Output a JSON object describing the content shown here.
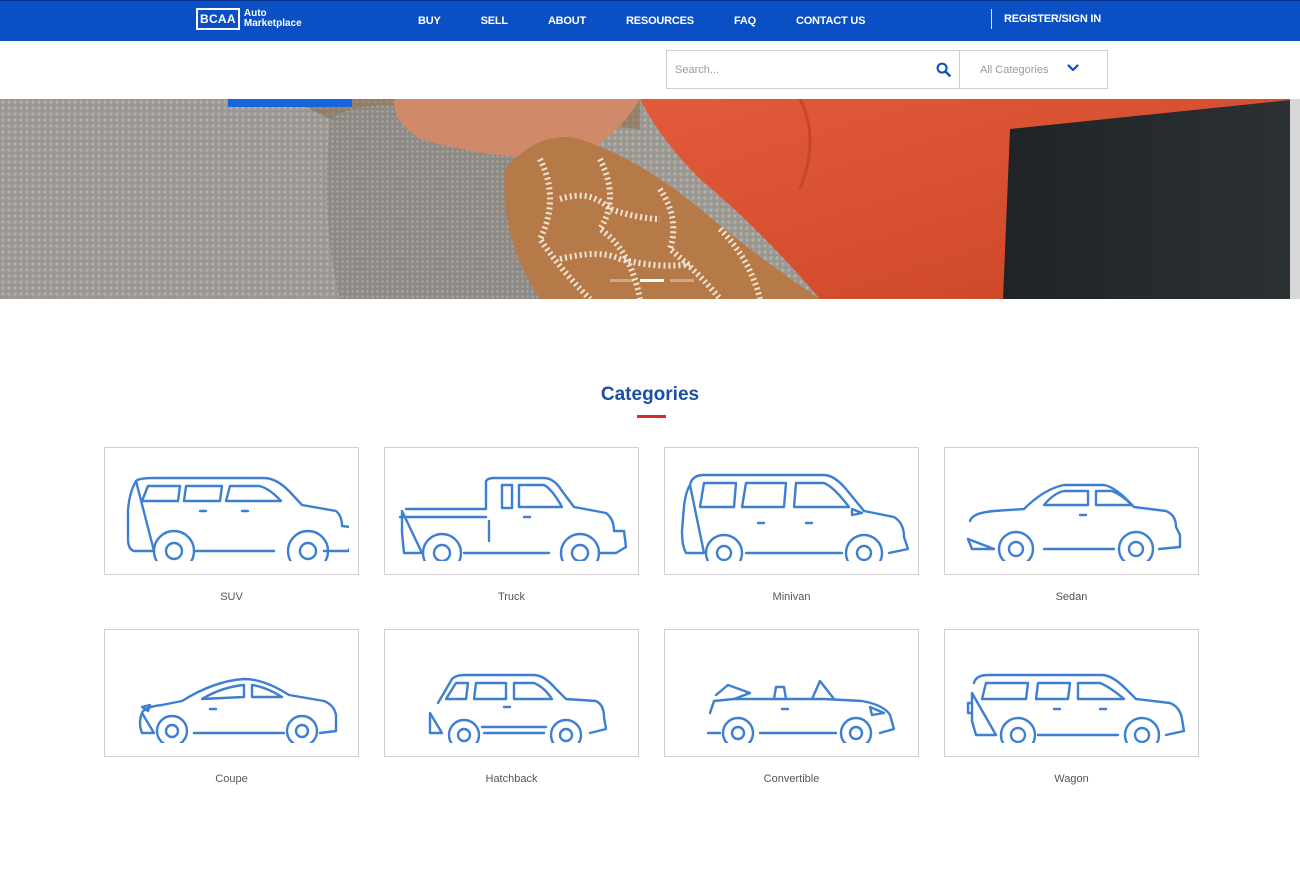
{
  "header": {
    "logo_mark": "BCAA",
    "logo_line1": "Auto",
    "logo_line2": "Marketplace",
    "nav": [
      "BUY",
      "SELL",
      "ABOUT",
      "RESOURCES",
      "FAQ",
      "CONTACT US"
    ],
    "signin": "REGISTER/SIGN IN"
  },
  "search": {
    "placeholder": "Search...",
    "category_value": "All Categories"
  },
  "hero": {
    "slide_count": 3,
    "active_slide": 2
  },
  "categories": {
    "title": "Categories",
    "items": [
      {
        "label": "SUV",
        "icon": "suv-icon"
      },
      {
        "label": "Truck",
        "icon": "truck-icon"
      },
      {
        "label": "Minivan",
        "icon": "minivan-icon"
      },
      {
        "label": "Sedan",
        "icon": "sedan-icon"
      },
      {
        "label": "Coupe",
        "icon": "coupe-icon"
      },
      {
        "label": "Hatchback",
        "icon": "hatchback-icon"
      },
      {
        "label": "Convertible",
        "icon": "convertible-icon"
      },
      {
        "label": "Wagon",
        "icon": "wagon-icon"
      }
    ]
  },
  "colors": {
    "brand_blue": "#0a4fc4",
    "title_blue": "#1b4fa3",
    "icon_blue": "#3d7fd0",
    "accent_red": "#d32a2a"
  }
}
